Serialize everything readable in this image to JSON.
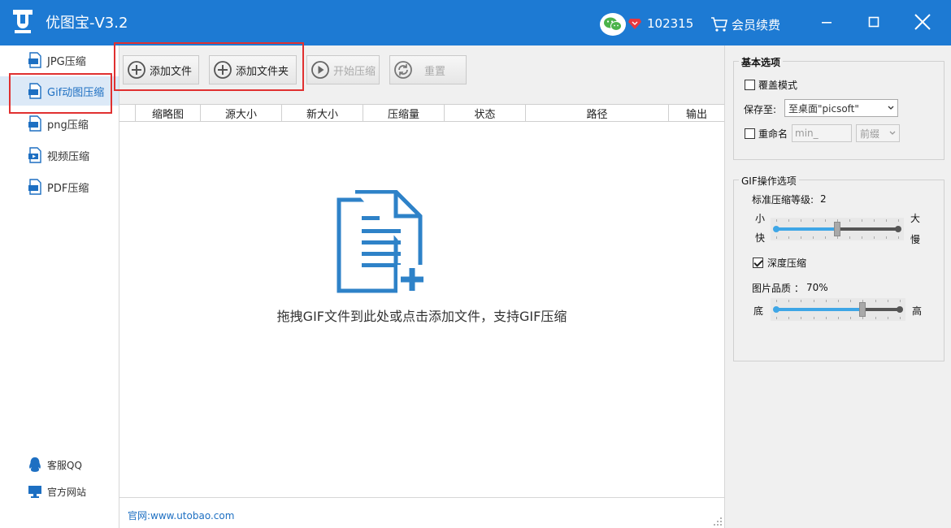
{
  "app": {
    "title": "优图宝-V3.2",
    "user_id": "102315",
    "renew_label": "会员续费"
  },
  "colors": {
    "brand": "#1d7ad3",
    "highlight_box": "#e03030",
    "slider_fill": "#3ea6e6"
  },
  "sidebar": {
    "items": [
      {
        "label": "JPG压缩",
        "icon": "jpg-file-icon",
        "active": false
      },
      {
        "label": "Gif动图压缩",
        "icon": "gif-file-icon",
        "active": true
      },
      {
        "label": "png压缩",
        "icon": "png-file-icon",
        "active": false
      },
      {
        "label": "视频压缩",
        "icon": "video-file-icon",
        "active": false
      },
      {
        "label": "PDF压缩",
        "icon": "pdf-file-icon",
        "active": false
      }
    ],
    "support_label": "客服QQ",
    "website_label": "官方网站"
  },
  "toolbar": {
    "add_file": "添加文件",
    "add_folder": "添加文件夹",
    "start": "开始压缩",
    "reset": "重置"
  },
  "table": {
    "columns": [
      "缩略图",
      "源大小",
      "新大小",
      "压缩量",
      "状态",
      "路径",
      "输出"
    ]
  },
  "drop_area": {
    "hint": "拖拽GIF文件到此处或点击添加文件，支持GIF压缩"
  },
  "status_bar": {
    "website": "官网:www.utobao.com"
  },
  "basic_options": {
    "title": "基本选项",
    "overwrite_label": "覆盖模式",
    "overwrite_checked": false,
    "save_to_label": "保存至:",
    "save_to_value": "至桌面\"picsoft\"",
    "rename_label": "重命名",
    "rename_checked": false,
    "rename_value": "min_",
    "rename_position": "前缀"
  },
  "gif_options": {
    "title": "GIF操作选项",
    "level_label": "标准压缩等级:",
    "level_value": "2",
    "level_fraction": 0.5,
    "small_label": "小",
    "fast_label": "快",
    "large_label": "大",
    "slow_label": "慢",
    "deep_label": "深度压缩",
    "deep_checked": true,
    "quality_label": "图片品质 ：",
    "quality_value": "70%",
    "quality_fraction": 0.7,
    "low_label": "底",
    "high_label": "高"
  }
}
